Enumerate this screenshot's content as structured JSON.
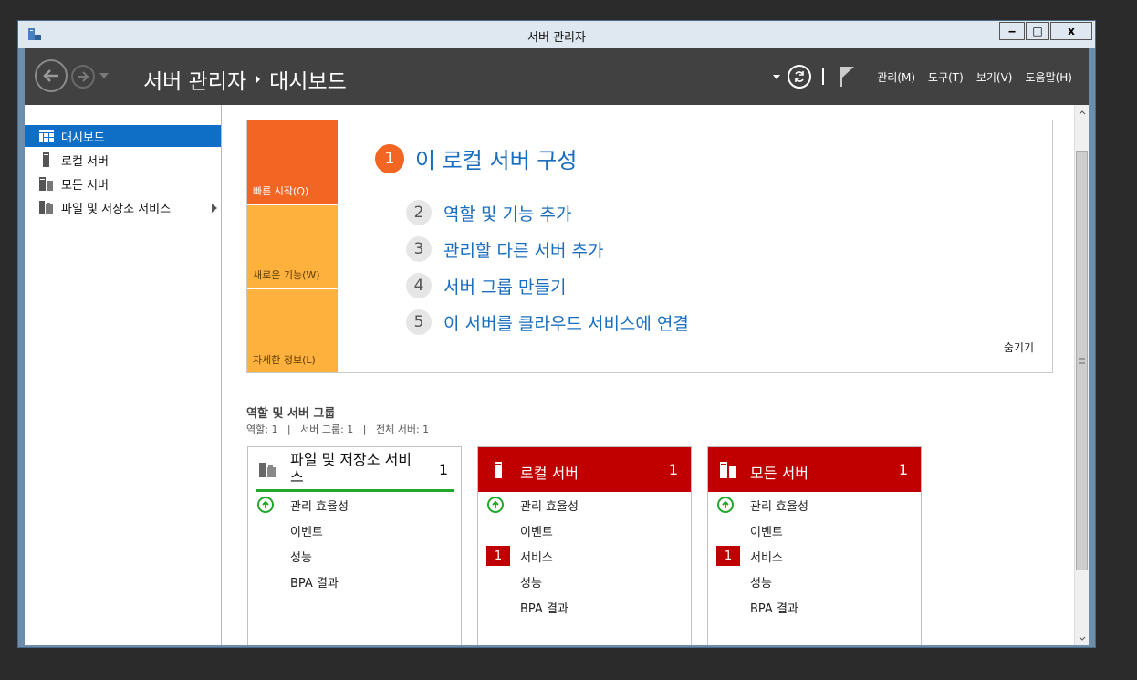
{
  "window": {
    "title": "서버 관리자",
    "controls": {
      "minimize": "‒",
      "maximize": "□",
      "close": "x"
    }
  },
  "header": {
    "breadcrumb": [
      "서버 관리자",
      "대시보드"
    ],
    "menu": [
      "관리(M)",
      "도구(T)",
      "보기(V)",
      "도움말(H)"
    ]
  },
  "sidebar": {
    "items": [
      {
        "label": "대시보드",
        "icon": "dashboard-icon",
        "active": true
      },
      {
        "label": "로컬 서버",
        "icon": "server-icon"
      },
      {
        "label": "모든 서버",
        "icon": "servers-icon"
      },
      {
        "label": "파일 및 저장소 서비스",
        "icon": "file-storage-icon",
        "has_submenu": true
      }
    ]
  },
  "quick_start": {
    "tiles": [
      "빠른 시작(Q)",
      "새로운 기능(W)",
      "자세한 정보(L)"
    ],
    "step1": {
      "number": "1",
      "label": "이 로컬 서버 구성"
    },
    "steps": [
      {
        "number": "2",
        "label": "역할 및 기능 추가"
      },
      {
        "number": "3",
        "label": "관리할 다른 서버 추가"
      },
      {
        "number": "4",
        "label": "서버 그룹 만들기"
      },
      {
        "number": "5",
        "label": "이 서버를 클라우드 서비스에 연결"
      }
    ],
    "hide": "숨기기"
  },
  "roles": {
    "title": "역할 및 서버 그룹",
    "summary": "역할: 1   |   서버 그룹: 1   |   전체 서버: 1",
    "cards": [
      {
        "title_line1": "파일 및 저장소 서비",
        "title_line2": "스",
        "count": "1",
        "rows": [
          "관리 효율성",
          "이벤트",
          "성능",
          "BPA 결과"
        ]
      },
      {
        "title": "로컬 서버",
        "count": "1",
        "rows": [
          "관리 효율성",
          "이벤트",
          "서비스",
          "성능",
          "BPA 결과"
        ],
        "services_badge": "1"
      },
      {
        "title": "모든 서버",
        "count": "1",
        "rows": [
          "관리 효율성",
          "이벤트",
          "서비스",
          "성능",
          "BPA 결과"
        ],
        "services_badge": "1"
      }
    ]
  },
  "colors": {
    "accent_blue": "#0f6fc6",
    "quickstart_orange": "#f26522",
    "tile_yellow": "#ffb13d",
    "alert_red": "#c00000",
    "ok_green": "#22a82a"
  }
}
